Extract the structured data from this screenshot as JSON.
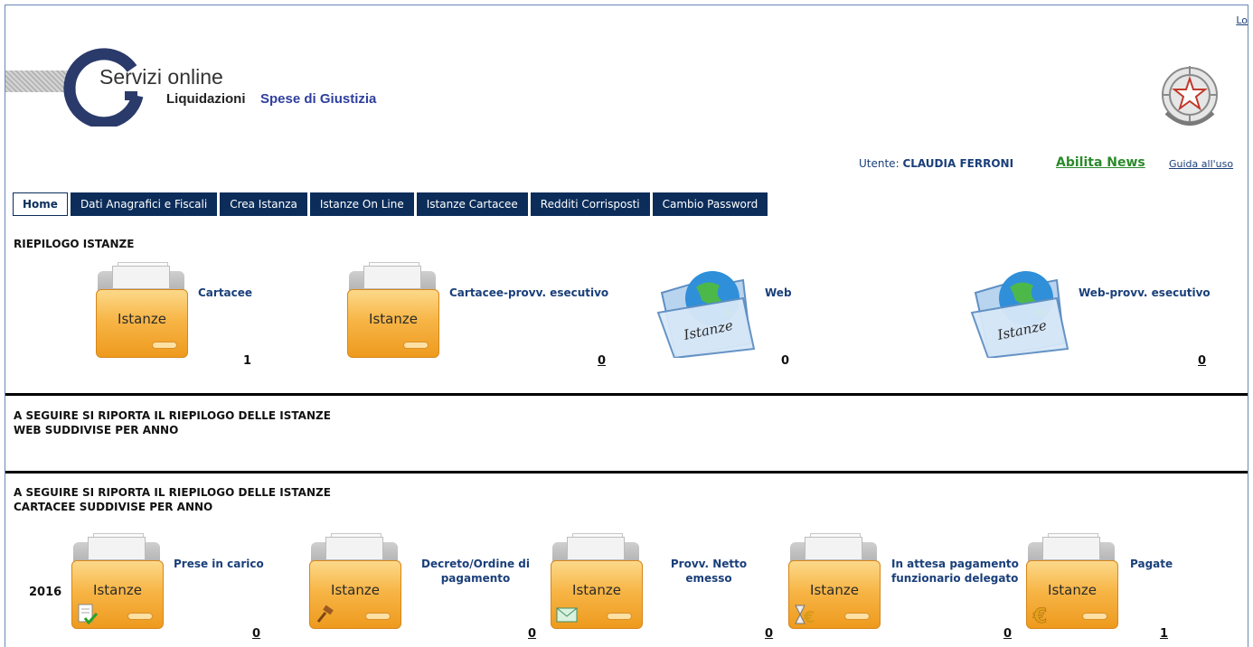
{
  "header": {
    "login_link": "Lo",
    "logo_title": "Servizi online",
    "logo_sub_bold": "Liquidazioni",
    "logo_sub_colored": "Spese di Giustizia",
    "user_label": "Utente:",
    "user_name": "CLAUDIA FERRONI",
    "news_link": "Abilita News",
    "guide_link": "Guida all'uso"
  },
  "nav": {
    "tabs": [
      {
        "label": "Home",
        "active": true
      },
      {
        "label": "Dati Anagrafici e Fiscali"
      },
      {
        "label": "Crea Istanza"
      },
      {
        "label": "Istanze On Line"
      },
      {
        "label": "Istanze Cartacee"
      },
      {
        "label": "Redditi Corrisposti"
      },
      {
        "label": "Cambio Password"
      }
    ]
  },
  "riepilogo": {
    "title": "RIEPILOGO ISTANZE",
    "icon_label": "Istanze",
    "items": [
      {
        "label": "Cartacee",
        "count": "1",
        "icon": "folder-icon"
      },
      {
        "label": "Cartacee-provv. esecutivo",
        "count": "0",
        "icon": "folder-icon"
      },
      {
        "label": "Web",
        "count": "0",
        "icon": "globe-folder-icon"
      },
      {
        "label": "Web-provv. esecutivo",
        "count": "0",
        "icon": "globe-folder-icon"
      }
    ]
  },
  "web_section": {
    "line1": "A SEGUIRE SI RIPORTA IL RIEPILOGO DELLE ISTANZE",
    "line2": "WEB SUDDIVISE PER ANNO"
  },
  "cartacee_section": {
    "line1": "A SEGUIRE SI RIPORTA IL RIEPILOGO DELLE ISTANZE",
    "line2": "CARTACEE SUDDIVISE PER ANNO",
    "year": "2016",
    "icon_label": "Istanze",
    "items": [
      {
        "line1": "Prese in carico",
        "line2": "",
        "count": "0",
        "badge": "check-document-icon"
      },
      {
        "line1": "Decreto/Ordine di",
        "line2": "pagamento",
        "count": "0",
        "badge": "gavel-icon"
      },
      {
        "line1": "Provv. Netto",
        "line2": "emesso",
        "count": "0",
        "badge": "envelope-icon"
      },
      {
        "line1": "In attesa pagamento",
        "line2": "funzionario delegato",
        "count": "0",
        "badge": "hourglass-euro-icon"
      },
      {
        "line1": "Pagate",
        "line2": "",
        "count": "1",
        "badge": "euro-icon"
      }
    ]
  },
  "colors": {
    "nav_bg": "#0c2d5a",
    "link": "#1a3f7a",
    "news": "#2b8a2b",
    "folder": "#f7b546",
    "brand_blue": "#2e3f9e"
  }
}
